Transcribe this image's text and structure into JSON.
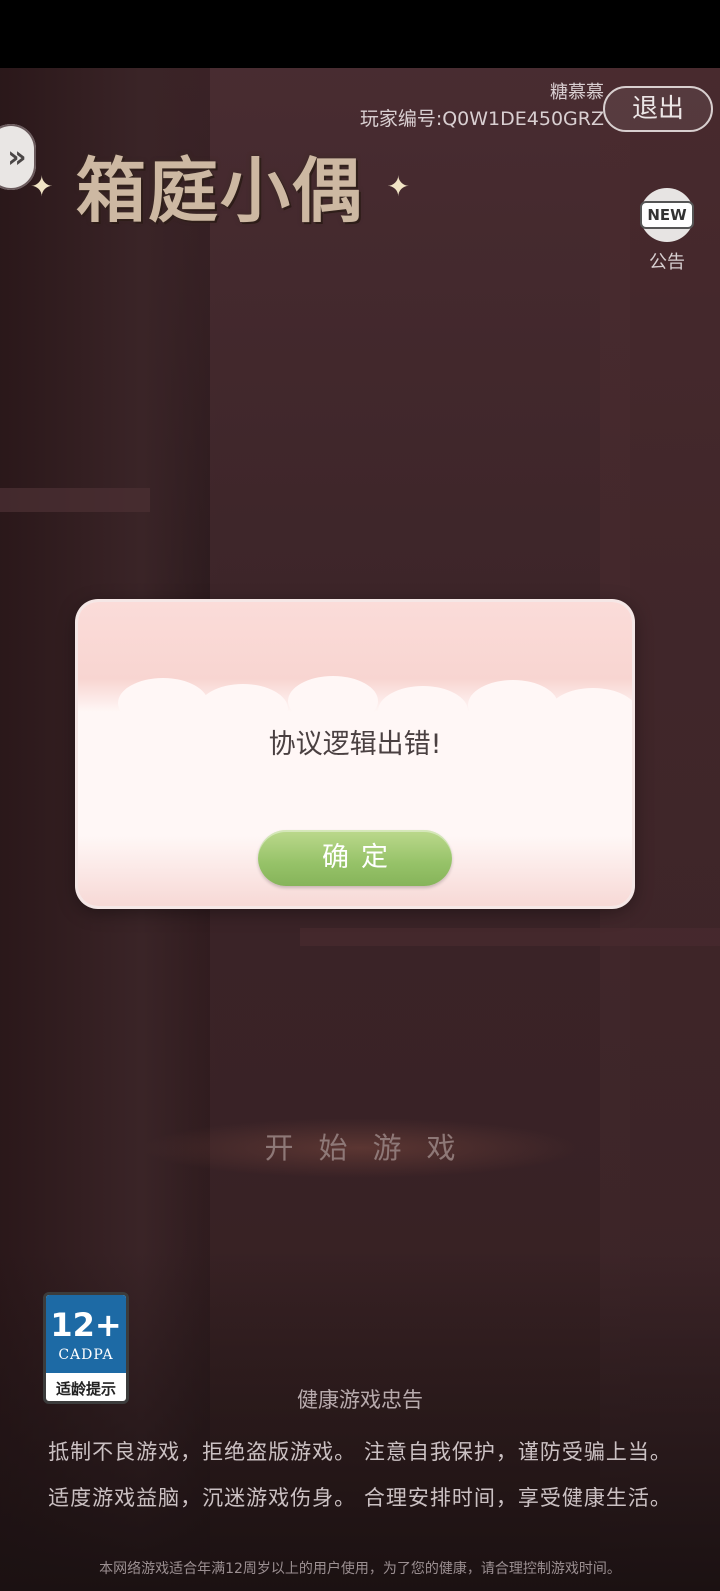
{
  "header": {
    "user_name": "糖慕慕",
    "player_id": "玩家编号:Q0W1DE450GRZ",
    "logout_label": "退出",
    "expand_icon": "double-chevron-right-icon"
  },
  "logo": {
    "title": "箱庭小偶"
  },
  "notice": {
    "badge_text": "NEW",
    "label": "公告",
    "icon": "new-notice-icon"
  },
  "dialog": {
    "message": "协议逻辑出错!",
    "confirm_label": "确定"
  },
  "start_button": {
    "label": "开始游戏"
  },
  "age_badge": {
    "rating": "12+",
    "org": "CADPA",
    "caption": "适龄提示"
  },
  "health_notice": {
    "title": "健康游戏忠告",
    "line1": "抵制不良游戏，拒绝盗版游戏。 注意自我保护，谨防受骗上当。",
    "line2": "适度游戏益脑，沉迷游戏伤身。 合理安排时间，享受健康生活。",
    "age_notice": "本网络游戏适合年满12周岁以上的用户使用，为了您的健康，请合理控制游戏时间。"
  }
}
